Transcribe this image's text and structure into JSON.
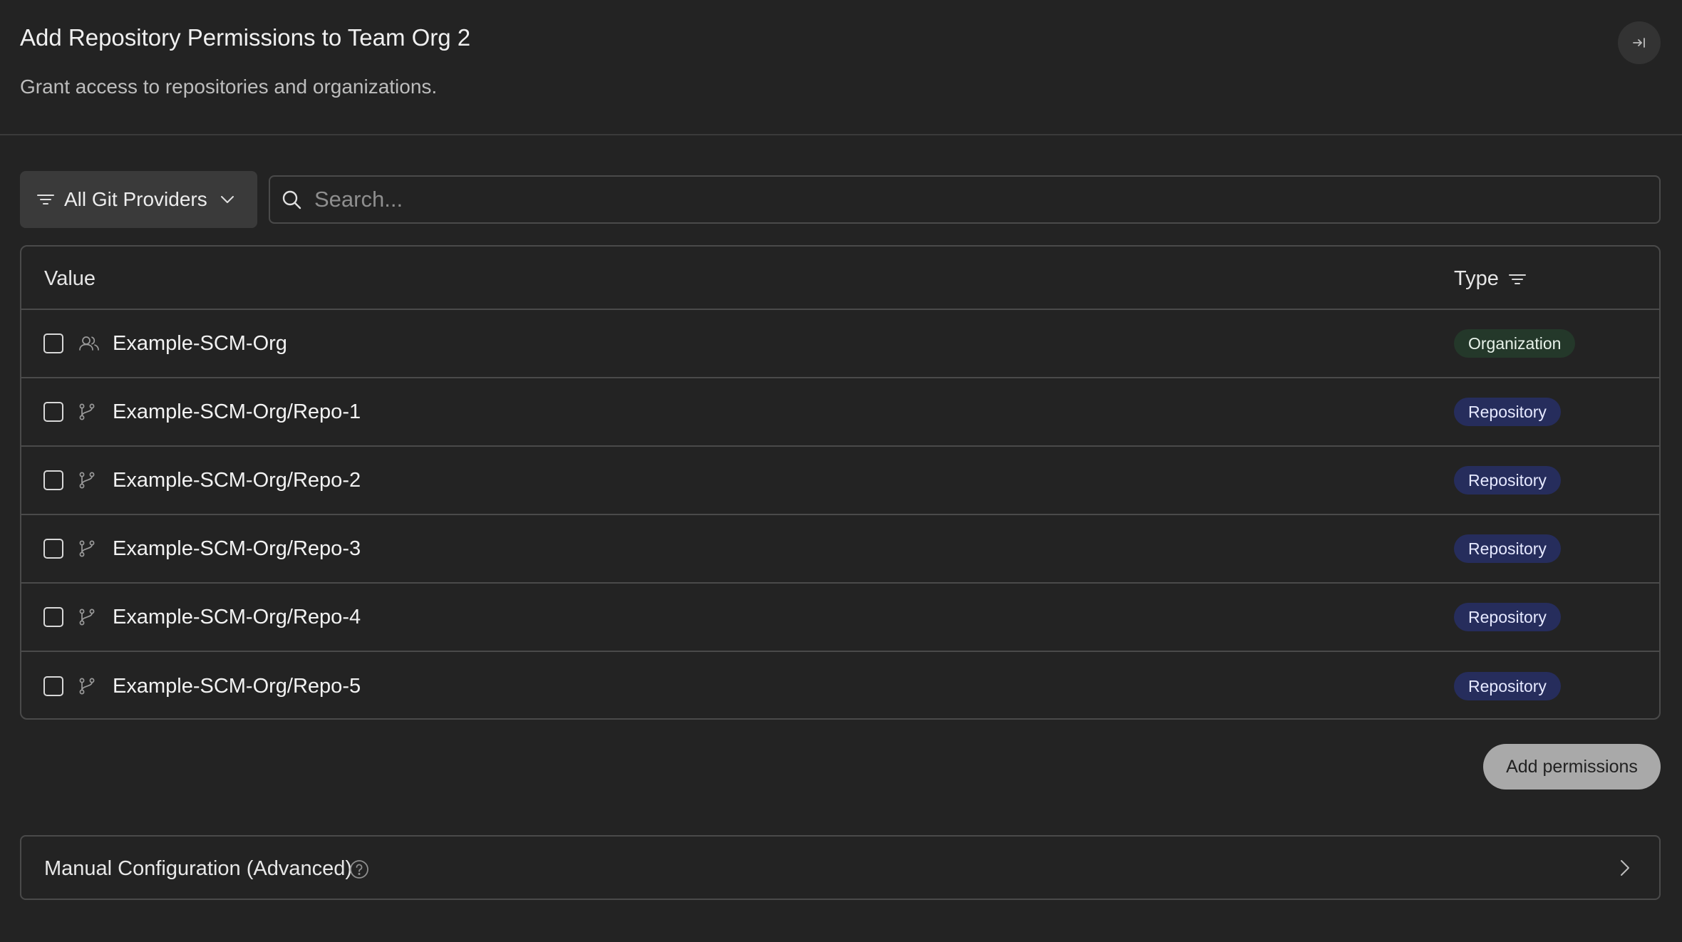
{
  "header": {
    "title": "Add Repository Permissions to Team Org 2",
    "subtitle": "Grant access to repositories and organizations."
  },
  "toolbar": {
    "provider_filter_label": "All Git Providers",
    "search_placeholder": "Search...",
    "search_value": ""
  },
  "table": {
    "columns": {
      "value": "Value",
      "type": "Type"
    },
    "rows": [
      {
        "label": "Example-SCM-Org",
        "type": "Organization",
        "icon": "users-icon",
        "checked": false
      },
      {
        "label": "Example-SCM-Org/Repo-1",
        "type": "Repository",
        "icon": "git-branch-icon",
        "checked": false
      },
      {
        "label": "Example-SCM-Org/Repo-2",
        "type": "Repository",
        "icon": "git-branch-icon",
        "checked": false
      },
      {
        "label": "Example-SCM-Org/Repo-3",
        "type": "Repository",
        "icon": "git-branch-icon",
        "checked": false
      },
      {
        "label": "Example-SCM-Org/Repo-4",
        "type": "Repository",
        "icon": "git-branch-icon",
        "checked": false
      },
      {
        "label": "Example-SCM-Org/Repo-5",
        "type": "Repository",
        "icon": "git-branch-icon",
        "checked": false
      }
    ]
  },
  "actions": {
    "add_permissions_label": "Add permissions"
  },
  "manual_config": {
    "label": "Manual Configuration (Advanced)"
  },
  "colors": {
    "background": "#232323",
    "organization_badge": "#24382a",
    "repository_badge": "#262d5c",
    "primary_button": "#a9a9a9"
  }
}
